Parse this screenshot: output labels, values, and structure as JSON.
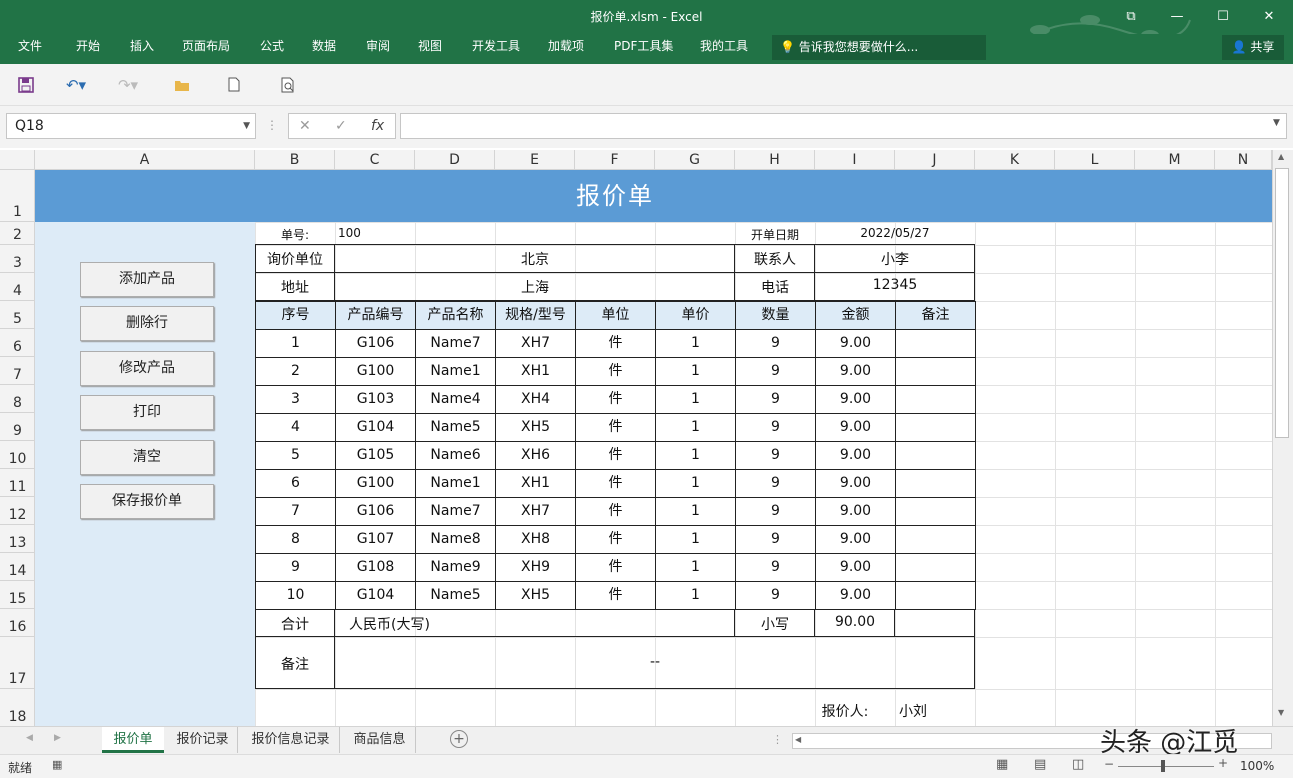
{
  "window": {
    "title": "报价单.xlsm - Excel",
    "restore": "⧉",
    "minimize": "—",
    "maximize": "☐",
    "close": "✕"
  },
  "ribbon": {
    "tabs": [
      "文件",
      "开始",
      "插入",
      "页面布局",
      "公式",
      "数据",
      "审阅",
      "视图",
      "开发工具",
      "加载项",
      "PDF工具集",
      "我的工具"
    ],
    "tell_me": "告诉我您想要做什么...",
    "share": "共享"
  },
  "formula_bar": {
    "name_box": "Q18",
    "formula": ""
  },
  "columns": [
    "A",
    "B",
    "C",
    "D",
    "E",
    "F",
    "G",
    "H",
    "I",
    "J",
    "K",
    "L",
    "M",
    "N"
  ],
  "rows": [
    "1",
    "2",
    "3",
    "4",
    "5",
    "6",
    "7",
    "8",
    "9",
    "10",
    "11",
    "12",
    "13",
    "14",
    "15",
    "16",
    "17",
    "18"
  ],
  "sheet": {
    "title": "报价单",
    "buttons": [
      "添加产品",
      "删除行",
      "修改产品",
      "打印",
      "清空",
      "保存报价单"
    ],
    "order_no_label": "单号:",
    "order_no": "100",
    "date_label": "开单日期",
    "date": "2022/05/27",
    "inquiry_label": "询价单位",
    "inquiry_value": "北京",
    "contact_label": "联系人",
    "contact_value": "小李",
    "address_label": "地址",
    "address_value": "上海",
    "phone_label": "电话",
    "phone_value": "12345",
    "table_headers": [
      "序号",
      "产品编号",
      "产品名称",
      "规格/型号",
      "单位",
      "单价",
      "数量",
      "金额",
      "备注"
    ],
    "table_rows": [
      [
        "1",
        "G106",
        "Name7",
        "XH7",
        "件",
        "1",
        "9",
        "9.00",
        ""
      ],
      [
        "2",
        "G100",
        "Name1",
        "XH1",
        "件",
        "1",
        "9",
        "9.00",
        ""
      ],
      [
        "3",
        "G103",
        "Name4",
        "XH4",
        "件",
        "1",
        "9",
        "9.00",
        ""
      ],
      [
        "4",
        "G104",
        "Name5",
        "XH5",
        "件",
        "1",
        "9",
        "9.00",
        ""
      ],
      [
        "5",
        "G105",
        "Name6",
        "XH6",
        "件",
        "1",
        "9",
        "9.00",
        ""
      ],
      [
        "6",
        "G100",
        "Name1",
        "XH1",
        "件",
        "1",
        "9",
        "9.00",
        ""
      ],
      [
        "7",
        "G106",
        "Name7",
        "XH7",
        "件",
        "1",
        "9",
        "9.00",
        ""
      ],
      [
        "8",
        "G107",
        "Name8",
        "XH8",
        "件",
        "1",
        "9",
        "9.00",
        ""
      ],
      [
        "9",
        "G108",
        "Name9",
        "XH9",
        "件",
        "1",
        "9",
        "9.00",
        ""
      ],
      [
        "10",
        "G104",
        "Name5",
        "XH5",
        "件",
        "1",
        "9",
        "9.00",
        ""
      ]
    ],
    "total_label": "合计",
    "total_words_label": "人民币(大写)",
    "total_small_label": "小写",
    "total_small": "90.00",
    "remark_label": "备注",
    "remark_value": "--",
    "quoter_label": "报价人:",
    "quoter_value": "小刘"
  },
  "sheet_tabs": [
    "报价单",
    "报价记录",
    "报价信息记录",
    "商品信息"
  ],
  "status": {
    "ready": "就绪",
    "zoom": "100%"
  },
  "watermark": "头条 @江觅",
  "colors": {
    "excel_green": "#217346",
    "banner_blue": "#5b9bd5",
    "panel_blue": "#ddebf7"
  }
}
